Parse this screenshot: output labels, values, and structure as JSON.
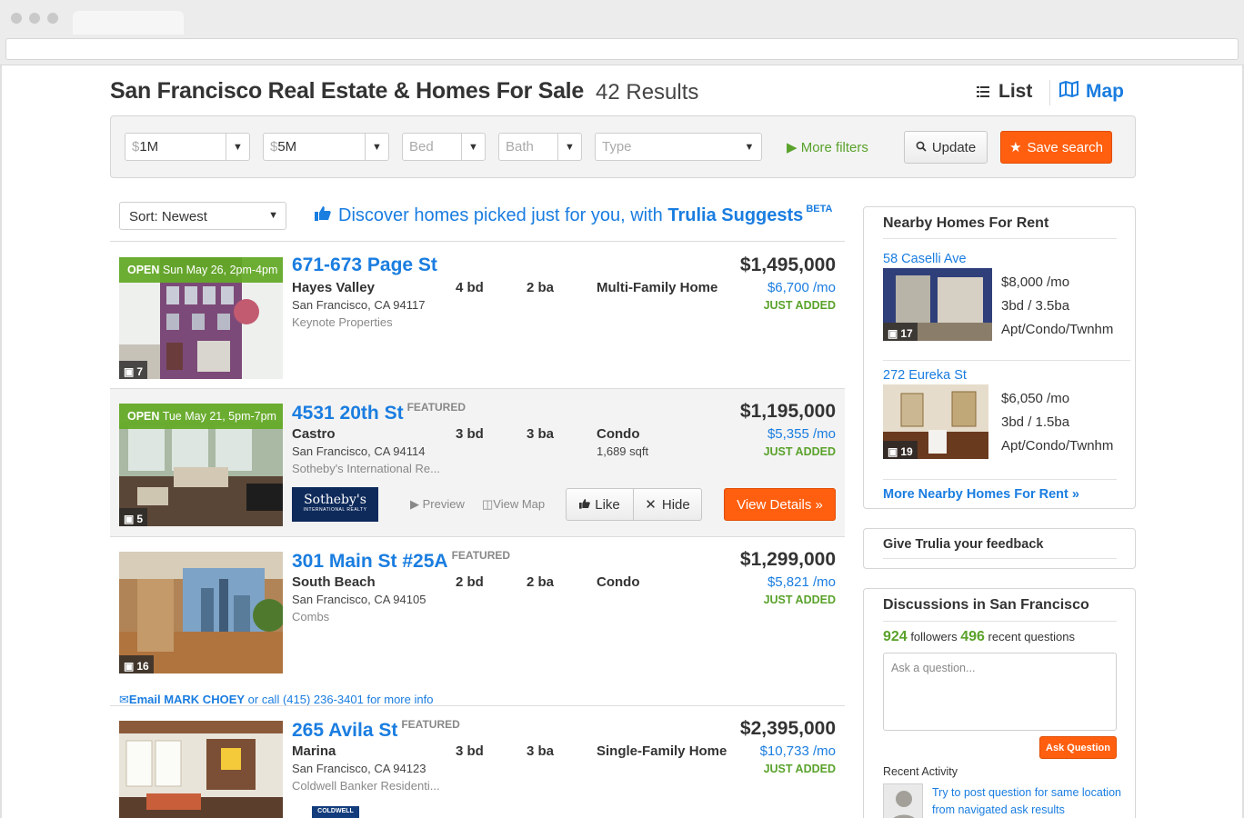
{
  "header": {
    "title": "San Francisco Real Estate & Homes For Sale",
    "result_count": "42 Results",
    "view_list": "List",
    "view_map": "Map"
  },
  "filters": {
    "price_min": {
      "currency": "$",
      "value": "1M"
    },
    "price_max": {
      "currency": "$",
      "value": "5M"
    },
    "bed_placeholder": "Bed",
    "bath_placeholder": "Bath",
    "type_placeholder": "Type",
    "more_filters": "More filters",
    "update": "Update",
    "save_search": "Save search"
  },
  "sort": {
    "label": "Sort: Newest"
  },
  "suggest": {
    "text": "Discover homes picked just for you, with ",
    "brand": "Trulia Suggests",
    "badge": "BETA"
  },
  "listings": [
    {
      "open": {
        "label": "OPEN",
        "when": "Sun May 26, 2pm-4pm"
      },
      "photo_count": "7",
      "address": "671-673 Page St",
      "featured": "",
      "neighborhood": "Hayes Valley",
      "city": "San Francisco, CA 94117",
      "broker": "Keynote Properties",
      "beds": "4 bd",
      "baths": "2 ba",
      "type": "Multi-Family Home",
      "sqft": "",
      "price": "$1,495,000",
      "rent": "$6,700 /mo",
      "status": "JUST ADDED"
    },
    {
      "open": {
        "label": "OPEN",
        "when": "Tue May 21, 5pm-7pm"
      },
      "photo_count": "5",
      "address": "4531 20th St",
      "featured": "FEATURED",
      "neighborhood": "Castro",
      "city": "San Francisco, CA 94114",
      "broker": "Sotheby's International Re...",
      "beds": "3 bd",
      "baths": "3 ba",
      "type": "Condo",
      "sqft": "1,689 sqft",
      "price": "$1,195,000",
      "rent": "$5,355 /mo",
      "status": "JUST ADDED",
      "broker_logo": {
        "name": "Sotheby's",
        "sub": "INTERNATIONAL REALTY"
      },
      "actions": {
        "preview": "Preview",
        "view_map": "View Map",
        "like": "Like",
        "hide": "Hide",
        "view_details": "View Details »"
      }
    },
    {
      "photo_count": "16",
      "address": "301 Main St #25A",
      "featured": "FEATURED",
      "neighborhood": "South Beach",
      "city": "San Francisco, CA 94105",
      "broker": "Combs",
      "beds": "2 bd",
      "baths": "2 ba",
      "type": "Condo",
      "sqft": "",
      "price": "$1,299,000",
      "rent": "$5,821 /mo",
      "status": "JUST ADDED",
      "contact": {
        "prefix": "Email ",
        "agent": "MARK CHOEY",
        "suffix": " or call (415) 236-3401 for more info"
      }
    },
    {
      "photo_count": "",
      "address": "265 Avila St",
      "featured": "FEATURED",
      "neighborhood": "Marina",
      "city": "San Francisco, CA 94123",
      "broker": "Coldwell Banker Residenti...",
      "beds": "3 bd",
      "baths": "3 ba",
      "type": "Single-Family Home",
      "sqft": "",
      "price": "$2,395,000",
      "rent": "$10,733 /mo",
      "status": "JUST ADDED",
      "broker_logo_text": "COLDWELL"
    }
  ],
  "sidebar": {
    "rentals": {
      "title": "Nearby Homes For Rent",
      "items": [
        {
          "address": "58 Caselli Ave",
          "price": "$8,000 /mo",
          "beds_baths": "3bd / 3.5ba",
          "type": "Apt/Condo/Twnhm",
          "photo_count": "17"
        },
        {
          "address": "272 Eureka St",
          "price": "$6,050 /mo",
          "beds_baths": "3bd / 1.5ba",
          "type": "Apt/Condo/Twnhm",
          "photo_count": "19"
        }
      ],
      "more": "More Nearby Homes For Rent  »"
    },
    "feedback": {
      "title": "Give Trulia your feedback"
    },
    "discussions": {
      "title": "Discussions in San Francisco",
      "followers_count": "924",
      "followers_label": " followers ",
      "questions_count": "496",
      "questions_label": " recent questions",
      "ask_placeholder": "Ask a question...",
      "ask_button": "Ask Question",
      "recent_label": "Recent Activity",
      "recent_item": "Try to post question for same location from navigated ask results"
    }
  },
  "colors": {
    "link_blue": "#1a7de0",
    "accent_orange": "#ff5f0f",
    "status_green": "#5aa22b"
  }
}
